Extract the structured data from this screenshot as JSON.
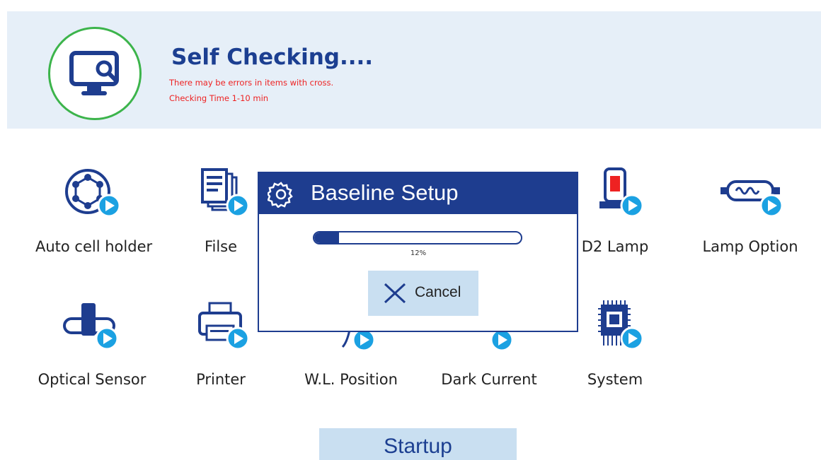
{
  "header": {
    "title": "Self Checking....",
    "notice": "There may be errors in items with cross.",
    "checking_time": "Checking Time 1-10 min",
    "icon": "monitor-search-icon",
    "ring_color": "#3cb44b"
  },
  "items": [
    {
      "label": "Auto cell holder",
      "icon": "cell-holder-icon"
    },
    {
      "label": "Filse",
      "icon": "file-icon"
    },
    {
      "label": "D2 Lamp",
      "icon": "d2-lamp-icon"
    },
    {
      "label": "Lamp Option",
      "icon": "lamp-option-icon"
    },
    {
      "label": "Optical Sensor",
      "icon": "optical-sensor-icon"
    },
    {
      "label": "Printer",
      "icon": "printer-icon"
    },
    {
      "label": "W.L. Position",
      "icon": "wavelength-position-icon"
    },
    {
      "label": "Dark Current",
      "icon": "dark-current-icon"
    },
    {
      "label": "System",
      "icon": "chip-icon"
    }
  ],
  "dialog": {
    "title": "Baseline Setup",
    "icon": "gear-icon",
    "progress": 12,
    "progress_text": "12%",
    "cancel_label": "Cancel"
  },
  "startup_label": "Startup",
  "colors": {
    "primary": "#1e3d8f",
    "header_bg": "#e6eff8",
    "button_bg": "#c9dff1",
    "play_badge": "#1ba1e2",
    "alert": "#ee2222"
  }
}
